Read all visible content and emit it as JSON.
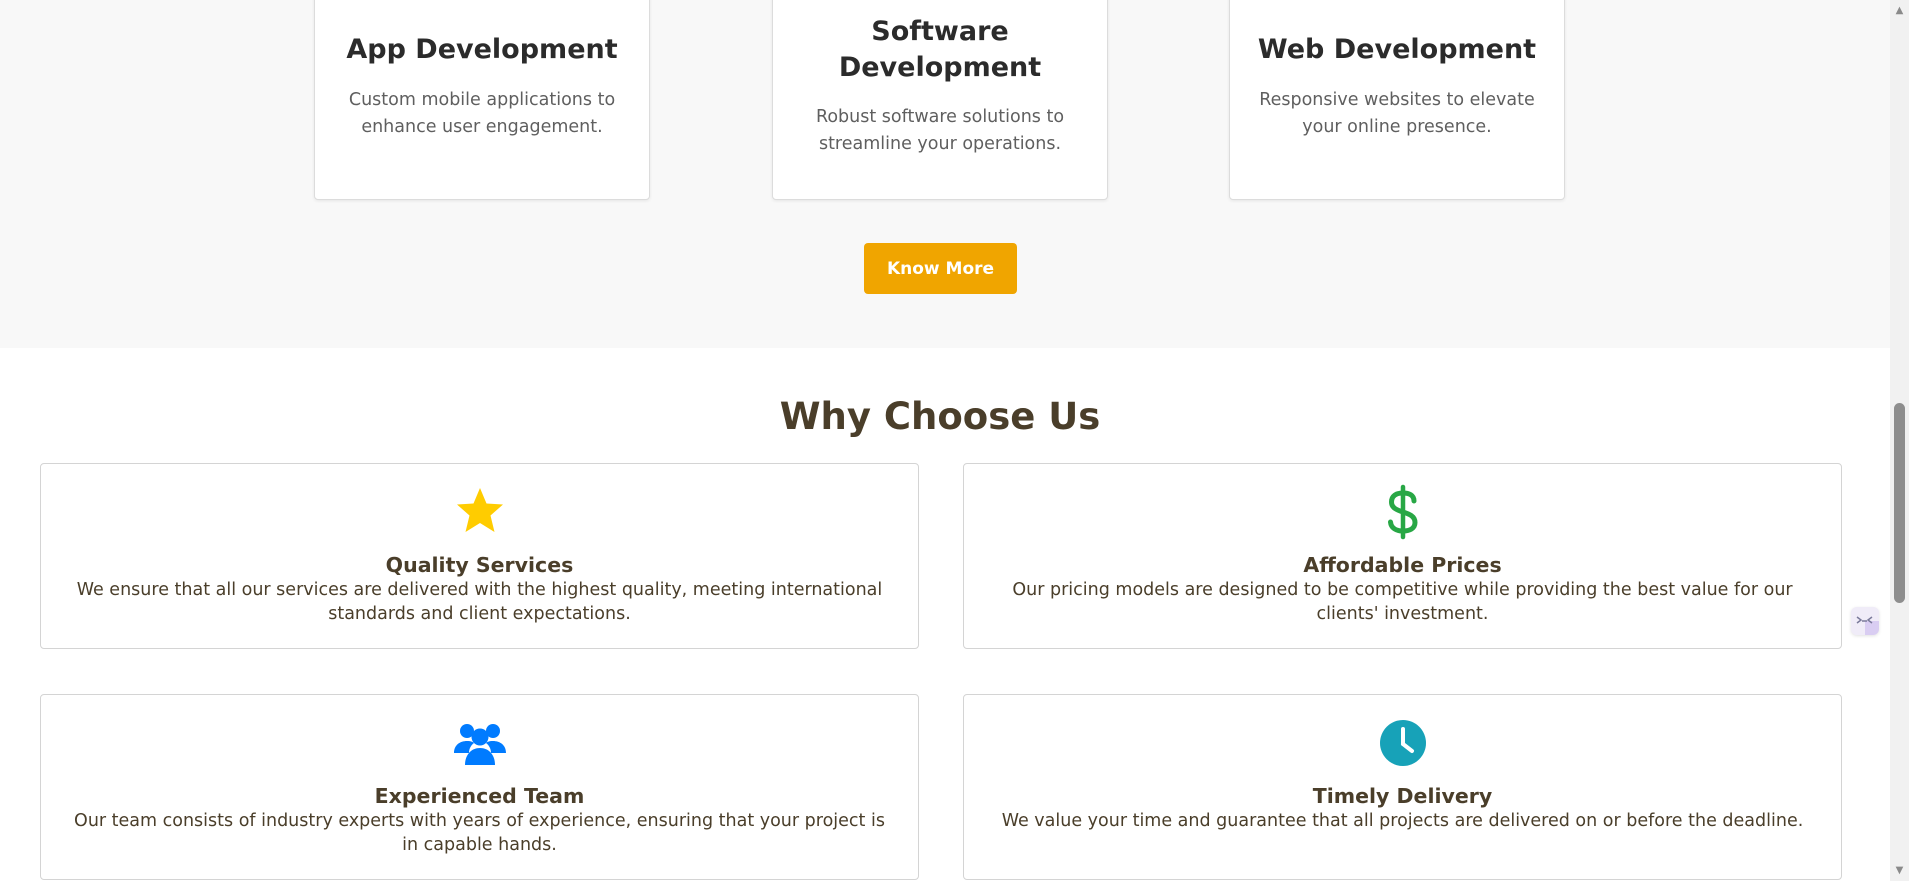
{
  "services": {
    "cards": [
      {
        "title": "App Development",
        "description": "Custom mobile applications to enhance user engagement."
      },
      {
        "title": "Software Development",
        "description": "Robust software solutions to streamline your operations."
      },
      {
        "title": "Web Development",
        "description": "Responsive websites to elevate your online presence."
      }
    ],
    "cta_label": "Know More",
    "cta_color": "#f0a500"
  },
  "why_choose_us": {
    "title": "Why Choose Us",
    "features": [
      {
        "icon": "star-icon",
        "icon_color": "#ffcc00",
        "title": "Quality Services",
        "description": "We ensure that all our services are delivered with the highest quality, meeting international standards and client expectations."
      },
      {
        "icon": "dollar-icon",
        "icon_color": "#28a745",
        "title": "Affordable Prices",
        "description": "Our pricing models are designed to be competitive while providing the best value for our clients' investment."
      },
      {
        "icon": "users-icon",
        "icon_color": "#007bff",
        "title": "Experienced Team",
        "description": "Our team consists of industry experts with years of experience, ensuring that your project is in capable hands."
      },
      {
        "icon": "clock-icon",
        "icon_color": "#17a2b8",
        "title": "Timely Delivery",
        "description": "We value your time and guarantee that all projects are delivered on or before the deadline."
      }
    ]
  },
  "colors": {
    "heading": "#4a3e2a",
    "services_bg": "#f8f8f8"
  }
}
